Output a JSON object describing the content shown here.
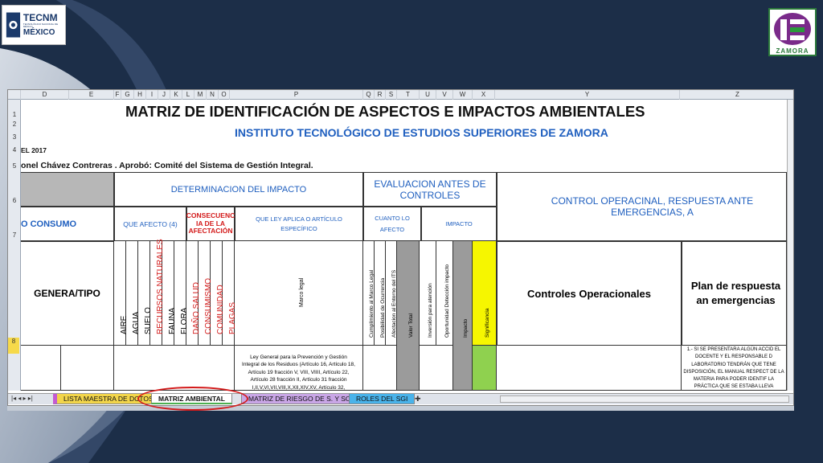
{
  "logos": {
    "left": {
      "line1": "TECNM",
      "line2": "TECNOLÓGICO NACIONAL DE MÉXICO",
      "line3": "MÉXICO"
    },
    "right": {
      "name": "ZAMORA"
    }
  },
  "columns": [
    "D",
    "E",
    "F",
    "G",
    "H",
    "I",
    "J",
    "K",
    "L",
    "M",
    "N",
    "O",
    "P",
    "Q",
    "R",
    "S",
    "T",
    "U",
    "V",
    "W",
    "X",
    "Y",
    "Z"
  ],
  "rows": [
    "1",
    "2",
    "3",
    "4",
    "5",
    "6",
    "7",
    "8"
  ],
  "sheet": {
    "title": "MATRIZ DE IDENTIFICACIÓN DE ASPECTOS E IMPACTOS AMBIENTALES",
    "subtitle": "INSTITUTO TECNOLÓGICO DE ESTUDIOS SUPERIORES DE ZAMORA",
    "row4": "EL 2017",
    "row5": "onel Chávez Contreras . Aprobó: Comité del Sistema de Gestión Integral.",
    "determinacion": "DETERMINACION DEL IMPACTO",
    "evaluacion": "EVALUACION ANTES DE CONTROLES",
    "control": "CONTROL OPERACINAL, RESPUESTA ANTE EMERGENCIAS, A",
    "consumo": "O  CONSUMO",
    "que_afecto": "QUE AFECTO (4)",
    "consecuencia": "CONSECUENC IA DE LA AFECTACIÓN",
    "que_ley": "QUE LEY APLICA O ARTÍCULO ESPECÍFICO",
    "cuanto": "CUANTO LO AFECTO",
    "impacto": "IMPACTO",
    "genera": "GENERA/TIPO",
    "affected": [
      "AIRE",
      "AGUA",
      "SUELO",
      "RECURSOS NATURALES",
      "FAUNA",
      "FLORA"
    ],
    "consequences": [
      "DAÑO SALUD",
      "CONSUMISMO",
      "COMUNIDAD",
      "PLAGAS"
    ],
    "marco": "Marco legal",
    "eval_cols": [
      "Cumplimiento al Marco Legal",
      "Posibilidad de Ocurrencia",
      "Afectacion al Entorno del ITS",
      "Valor Total",
      "Inversión para atención",
      "Oportunidad Detección impacto",
      "Impacto",
      "Significancia"
    ],
    "controles": "Controles Operacionales",
    "plan": "Plan de respuesta an emergencias",
    "ley_text": "Ley General para la Prevención y Gestión Integral de los Residuos (Artículo 16, Artículo 18, Artículo 19 fracción V, VIII, VIIII, Artículo 22, Artículo 28 fracción II, Artículo 31 fracción I,II,V,VI,VII,VIII,X,XII,XIV,XV, Artículo 32,",
    "plan_text": "1.- SI SE PRESENTARA ALGÚN ACCID EL DOCENTE Y EL RESPONSABLE D LABORATORIO TENDRÁN QUE TENE DISPOSICIÓN, EL MANUAL RESPECT DE LA MATERIA PARA PODER IDENTIF LA PRÁCTICA QUE SE ESTABA LLEVA"
  },
  "tabs": [
    "LISTA MAESTRA DE DCTOS",
    "MATRIZ AMBIENTAL",
    "MATRIZ DE RIESGO DE S. Y SO",
    "ROLES DEL SGI"
  ],
  "colors": {
    "background": "#1c2e48",
    "header_blue": "#1f5fbf",
    "red": "#d31a1a",
    "yellow": "#f6f600",
    "green": "#8fd14f",
    "grey": "#9b9b9b"
  }
}
